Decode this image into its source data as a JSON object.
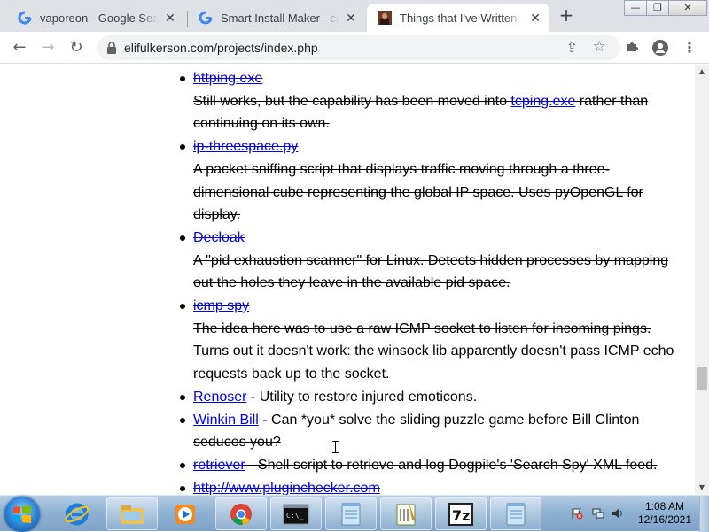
{
  "browser": {
    "tabs": [
      {
        "title": "vaporeon - Google Search",
        "favicon": "google-g-icon",
        "active": false
      },
      {
        "title": "Smart Install Maker - creat",
        "favicon": "google-g-icon",
        "active": false
      },
      {
        "title": "Things that I've Written:",
        "favicon": "avatar-photo-icon",
        "active": true
      }
    ],
    "new_tab_label": "+",
    "window_controls": {
      "minimize": "—",
      "maximize": "❐",
      "close": "✕"
    },
    "url": "elifulkerson.com/projects/index.php"
  },
  "page": {
    "items": [
      {
        "link": "httping.exe",
        "desc_before": "Still works, but the capability has been moved into ",
        "desc_link": "tcping.exe",
        "desc_after": " rather than continuing on its own."
      },
      {
        "link": "ip-threespace.py",
        "desc": "A packet sniffing script that displays traffic moving through a three-dimensional cube representing the global IP space. Uses pyOpenGL for display."
      },
      {
        "link": "Decloak",
        "desc": "A \"pid exhaustion scanner\" for Linux. Detects hidden processes by mapping out the holes they leave in the available pid space."
      },
      {
        "link": "icmp spy",
        "desc": "The idea here was to use a raw ICMP socket to listen for incoming pings. Turns out it doesn't work: the winsock lib apparently doesn't pass ICMP echo requests back up to the socket."
      },
      {
        "link": "Renoser",
        "inline": " - Utility to restore injured emoticons."
      },
      {
        "link": "Winkin Bill",
        "inline": " - Can *you* solve the sliding puzzle game before Bill Clinton seduces you?"
      },
      {
        "link": "retriever",
        "inline": " - Shell script to retrieve and log Dogpile's 'Search Spy' XML feed."
      },
      {
        "link": "http://www.pluginchecker.com",
        "inline": ""
      }
    ]
  },
  "taskbar": {
    "buttons": [
      "internet-explorer-icon",
      "windows-explorer-icon",
      "media-player-icon",
      "chrome-icon",
      "command-prompt-icon",
      "notepad-icon",
      "notepad-plus-icon",
      "7zip-icon",
      "notepad-icon"
    ],
    "clock": {
      "time": "1:08 AM",
      "date": "12/16/2021"
    }
  },
  "colors": {
    "link": "#0000ee",
    "tabstrip": "#dee1e6",
    "omnibox": "#f1f3f4",
    "taskbar": "#8fb1d3"
  }
}
